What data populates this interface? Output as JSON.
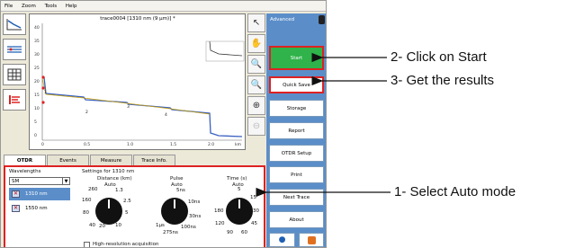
{
  "menubar": {
    "items": [
      "File",
      "Zoom",
      "Tools",
      "Help"
    ]
  },
  "graph": {
    "title": "trace0004 [1310 nm (9 µm)] *",
    "y_ticks": [
      "40",
      "35",
      "30",
      "25",
      "20",
      "15",
      "10",
      "5",
      "0"
    ],
    "x_ticks": [
      "0",
      "0.5",
      "1.0",
      "1.5",
      "2.0",
      "km"
    ],
    "event_labels": [
      "1",
      "2",
      "3",
      "4"
    ]
  },
  "right_panel": {
    "mode": "Advanced",
    "buttons": {
      "start": "Start",
      "quick_save": "Quick Save",
      "storage": "Storage",
      "report": "Report",
      "otdr_setup": "OTDR Setup",
      "print": "Print",
      "next": "Next Trace",
      "about": "About"
    }
  },
  "tabs": [
    "OTDR",
    "Events",
    "Measure",
    "Trace Info."
  ],
  "otdr": {
    "wavelengths_label": "Wavelengths",
    "mode_select": "SM",
    "wavelengths": [
      "1310 nm",
      "1550 nm"
    ],
    "settings_title": "Settings for 1310 nm",
    "distance": {
      "label": "Distance (km)",
      "mode": "Auto",
      "ticks": [
        "260",
        "1.3",
        "2.5",
        "5",
        "10",
        "20",
        "40",
        "80",
        "160"
      ]
    },
    "pulse": {
      "label": "Pulse",
      "mode": "Auto",
      "ticks": [
        "5ns",
        "10ns",
        "30ns",
        "100ns",
        "275ns",
        "1µs"
      ]
    },
    "time": {
      "label": "Time (s)",
      "mode": "Auto",
      "ticks": [
        "5",
        "15",
        "30",
        "45",
        "60",
        "90",
        "120",
        "180"
      ]
    },
    "high_res": "High-resolution acquisition"
  },
  "annotations": {
    "step2": "2- Click on Start",
    "step3": "3- Get the results",
    "step1": "1- Select Auto mode"
  },
  "colors": {
    "accent": "#5b8ec9",
    "start": "#2fb34a",
    "highlight": "#dd2222"
  }
}
